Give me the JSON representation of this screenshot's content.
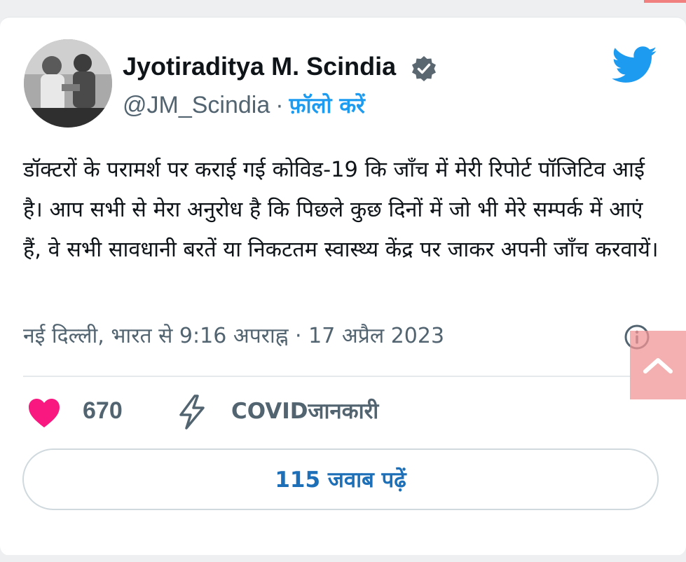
{
  "tweet": {
    "author": {
      "display_name": "Jyotiraditya M. Scindia",
      "handle": "@JM_Scindia",
      "separator": "·",
      "follow_label": "फ़ॉलो करें"
    },
    "text": "डॉक्टरों के परामर्श पर कराई गई कोविड-19 कि जाँच में मेरी रिपोर्ट पॉजिटिव आई है। आप सभी से मेरा अनुरोध है कि पिछले कुछ दिनों में जो भी मेरे सम्पर्क में आएं हैं, वे सभी सावधानी बरतें या निकटतम स्वास्थ्य केंद्र पर जाकर अपनी जाँच करवायें।",
    "meta": {
      "location": "नई दिल्ली, भारत से",
      "time": "9:16 अपराह्न",
      "separator": "·",
      "date": "17 अप्रैल 2023"
    },
    "likes": "670",
    "topic_label": "COVIDजानकारी",
    "replies_button_label": "115 जवाब पढ़ें"
  },
  "icons": {
    "verified": "verified-badge-icon",
    "brand": "twitter-bird-icon",
    "info": "info-icon",
    "like": "heart-icon",
    "topic": "lightning-bolt-icon",
    "scroll": "chevron-up-icon"
  },
  "colors": {
    "brand_blue": "#1d9bf0",
    "reply_link": "#1d70b8",
    "heart": "#f91880",
    "muted": "#536471",
    "text": "#0f1419"
  }
}
